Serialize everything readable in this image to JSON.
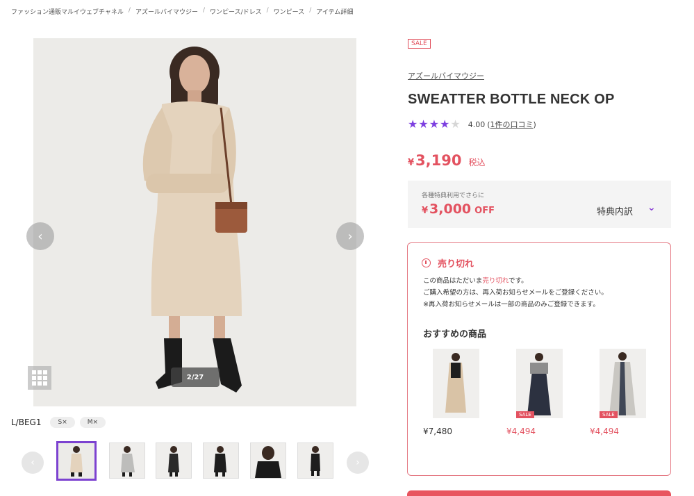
{
  "breadcrumb": [
    "ファッション通販マルイウェブチャネル",
    "アズールバイマウジー",
    "ワンピース/ドレス",
    "ワンピース",
    "アイテム詳細"
  ],
  "gallery": {
    "counter": "2/27",
    "variant_label": "L/BEG1",
    "sizes": [
      "S×",
      "M×"
    ],
    "thumbnail_count": 6,
    "active_thumbnail": 1
  },
  "product": {
    "sale_tag": "SALE",
    "brand": "アズールバイマウジー",
    "title": "SWEATTER BOTTLE NECK OP",
    "rating": 4,
    "rating_max": 5,
    "rating_text": "4.00",
    "review_open": "(",
    "review_link": "1件の口コミ",
    "review_close": ")",
    "price_yen": "¥",
    "price": "3,190",
    "tax_label": "税込"
  },
  "benefit": {
    "note": "各種特典利用でさらに",
    "yen": "¥",
    "amount": "3,000",
    "off_label": "OFF",
    "detail_label": "特典内訳"
  },
  "soldout": {
    "title": "売り切れ",
    "line1_pre": "この商品はただいま",
    "line1_red": "売り切れ",
    "line1_post": "です。",
    "line2": "ご購入希望の方は、再入荷お知らせメールをご登録ください。",
    "line3": "※再入荷お知らせメールは一部の商品のみご登録できます。",
    "rec_heading": "おすすめの商品",
    "recommendations": [
      {
        "price": "¥7,480",
        "sale": false,
        "sale_label": ""
      },
      {
        "price": "¥4,494",
        "sale": true,
        "sale_label": "SALE"
      },
      {
        "price": "¥4,494",
        "sale": true,
        "sale_label": "SALE"
      }
    ]
  },
  "colors": {
    "accent": "#7c42d0",
    "sale_red": "#e35260"
  }
}
